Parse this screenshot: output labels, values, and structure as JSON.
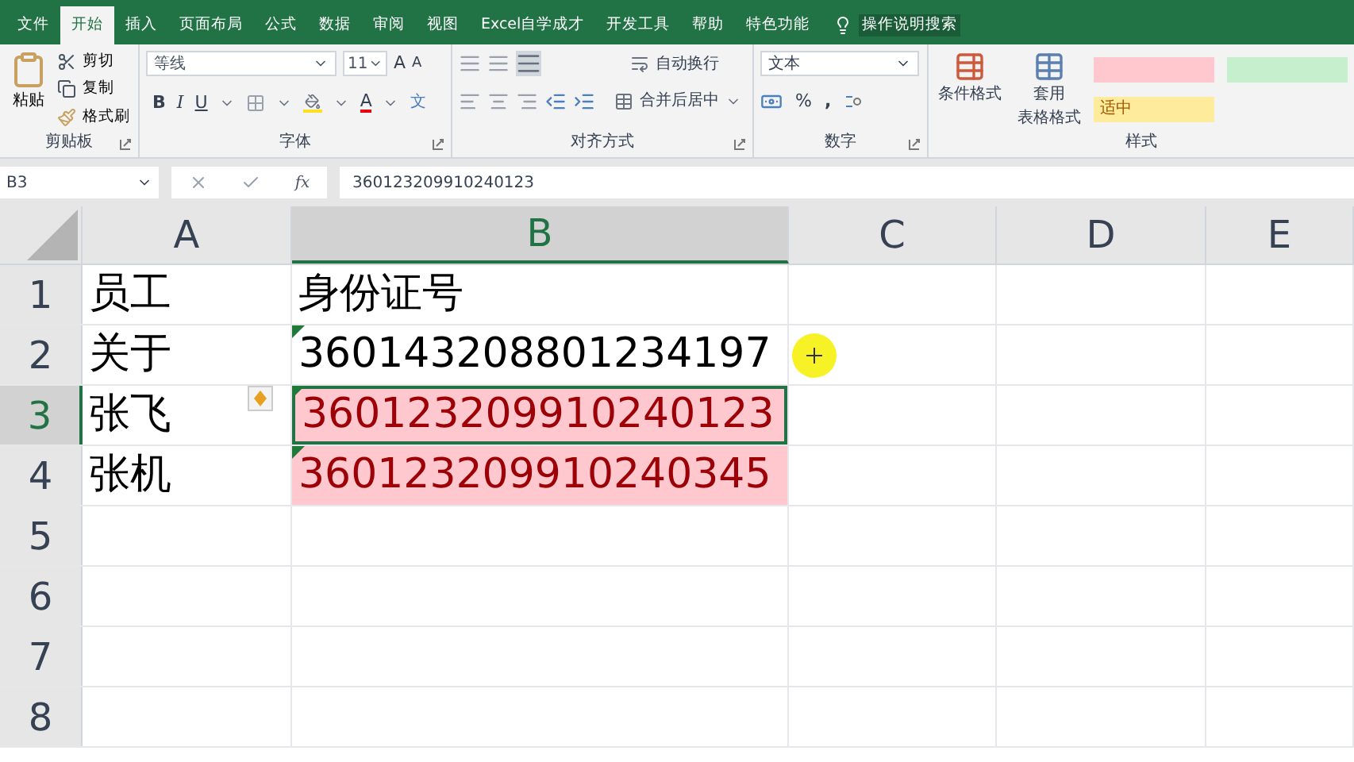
{
  "tabs": [
    {
      "label": "文件",
      "selected": false
    },
    {
      "label": "开始",
      "selected": true
    },
    {
      "label": "插入",
      "selected": false
    },
    {
      "label": "页面布局",
      "selected": false
    },
    {
      "label": "公式",
      "selected": false
    },
    {
      "label": "数据",
      "selected": false
    },
    {
      "label": "审阅",
      "selected": false
    },
    {
      "label": "视图",
      "selected": false
    },
    {
      "label": "Excel自学成才",
      "selected": false
    },
    {
      "label": "开发工具",
      "selected": false
    },
    {
      "label": "帮助",
      "selected": false
    },
    {
      "label": "特色功能",
      "selected": false
    }
  ],
  "tell_me": "操作说明搜索",
  "ribbon": {
    "clipboard": {
      "paste": "粘贴",
      "cut": "剪切",
      "copy": "复制",
      "painter": "格式刷",
      "label": "剪贴板"
    },
    "font": {
      "name": "等线",
      "size": "11",
      "grow": "A",
      "shrink": "A",
      "bold": "B",
      "italic": "I",
      "underline": "U",
      "font_color": "A",
      "phonetic": "文",
      "label": "字体"
    },
    "alignment": {
      "wrap": "自动换行",
      "merge": "合并后居中",
      "label": "对齐方式"
    },
    "number": {
      "format": "文本",
      "percent": "%",
      "comma": ",",
      "label": "数字"
    },
    "styles": {
      "conditional": "条件格式",
      "table_format_1": "套用",
      "table_format_2": "表格格式",
      "gallery": [
        {
          "color": "#ffc7ce"
        },
        {
          "color": "#c6efce"
        },
        {
          "color": "#ffeb9c",
          "label": "适中"
        }
      ],
      "label": "样式"
    }
  },
  "formula_bar": {
    "name_box": "B3",
    "fx": "fx",
    "formula": "360123209910240123"
  },
  "columns": [
    {
      "label": "A",
      "selected": false
    },
    {
      "label": "B",
      "selected": true
    },
    {
      "label": "C",
      "selected": false
    },
    {
      "label": "D",
      "selected": false
    },
    {
      "label": "E",
      "selected": false
    }
  ],
  "rows": [
    {
      "label": "1",
      "selected": false,
      "cells": [
        {
          "text": "员工",
          "error_flag": false,
          "highlighted": false,
          "selected": false
        },
        {
          "text": "身份证号",
          "error_flag": false,
          "highlighted": false,
          "selected": false
        }
      ]
    },
    {
      "label": "2",
      "selected": false,
      "cells": [
        {
          "text": "关于",
          "error_flag": false,
          "highlighted": false,
          "selected": false
        },
        {
          "text": "360143208801234197",
          "error_flag": true,
          "highlighted": false,
          "selected": false
        }
      ]
    },
    {
      "label": "3",
      "selected": true,
      "cells": [
        {
          "text": "张飞",
          "error_flag": false,
          "highlighted": false,
          "selected": false
        },
        {
          "text": "360123209910240123",
          "error_flag": true,
          "highlighted": true,
          "selected": true
        }
      ]
    },
    {
      "label": "4",
      "selected": false,
      "cells": [
        {
          "text": "张机",
          "error_flag": false,
          "highlighted": false,
          "selected": false
        },
        {
          "text": "360123209910240345",
          "error_flag": true,
          "highlighted": true,
          "selected": false
        }
      ]
    },
    {
      "label": "5",
      "selected": false,
      "cells": []
    },
    {
      "label": "6",
      "selected": false,
      "cells": []
    },
    {
      "label": "7",
      "selected": false,
      "cells": []
    },
    {
      "label": "8",
      "selected": false,
      "cells": []
    }
  ]
}
